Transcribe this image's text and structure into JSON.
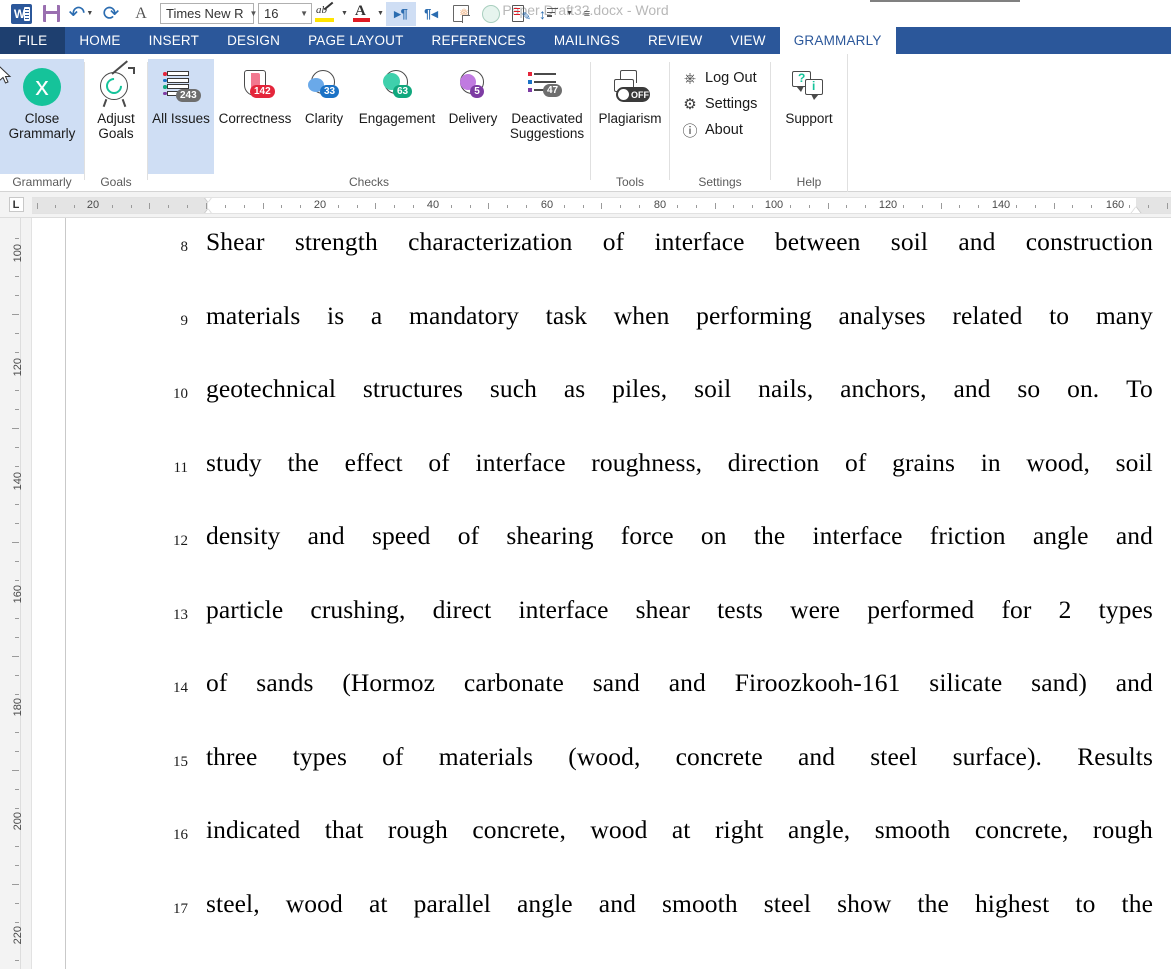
{
  "window": {
    "document_title": "Paper Draft32.docx - Word"
  },
  "quick_access": {
    "items": [
      {
        "name": "word-logo-icon",
        "label": "W"
      },
      {
        "name": "save-icon",
        "label": "Save"
      },
      {
        "name": "undo-icon",
        "label": "Undo"
      },
      {
        "name": "redo-icon",
        "label": "Redo"
      },
      {
        "name": "font-style-icon",
        "label": "A"
      },
      {
        "name": "highlight-icon",
        "label": "Text Highlight Color"
      },
      {
        "name": "font-color-icon",
        "label": "Font Color"
      },
      {
        "name": "ltr-text-direction-icon",
        "label": "Left-to-Right Text Direction"
      },
      {
        "name": "rtl-text-direction-icon",
        "label": "Right-to-Left Text Direction"
      },
      {
        "name": "new-document-icon",
        "label": "New"
      },
      {
        "name": "circle-icon",
        "label": "Circle"
      },
      {
        "name": "track-changes-icon",
        "label": "Track Changes"
      },
      {
        "name": "sort-icon",
        "label": "Sort"
      },
      {
        "name": "customize-toolbar-icon",
        "label": "Customize Quick Access Toolbar"
      }
    ],
    "font_name": "Times New R",
    "font_size": "16"
  },
  "ribbon_tabs": [
    {
      "label": "FILE",
      "active": false,
      "file": true
    },
    {
      "label": "HOME",
      "active": false
    },
    {
      "label": "INSERT",
      "active": false
    },
    {
      "label": "DESIGN",
      "active": false
    },
    {
      "label": "PAGE LAYOUT",
      "active": false
    },
    {
      "label": "REFERENCES",
      "active": false
    },
    {
      "label": "MAILINGS",
      "active": false
    },
    {
      "label": "REVIEW",
      "active": false
    },
    {
      "label": "VIEW",
      "active": false
    },
    {
      "label": "GRAMMARLY",
      "active": true
    }
  ],
  "ribbon": {
    "groups": {
      "grammarly": {
        "label": "Grammarly",
        "close_button": {
          "line1": "Close",
          "line2": "Grammarly",
          "selected": true
        }
      },
      "goals": {
        "label": "Goals",
        "adjust_button": {
          "line1": "Adjust",
          "line2": "Goals"
        }
      },
      "checks": {
        "label": "Checks",
        "buttons": [
          {
            "label": "All Issues",
            "badge": "243",
            "badge_color": "gray",
            "selected": true
          },
          {
            "label": "Correctness",
            "badge": "142",
            "badge_color": "red",
            "selected": false
          },
          {
            "label": "Clarity",
            "badge": "33",
            "badge_color": "blue",
            "selected": false
          },
          {
            "label": "Engagement",
            "badge": "63",
            "badge_color": "green",
            "selected": false
          },
          {
            "label": "Delivery",
            "badge": "5",
            "badge_color": "purple",
            "selected": false
          },
          {
            "label": "Deactivated Suggestions",
            "label_line1": "Deactivated",
            "label_line2": "Suggestions",
            "badge": "47",
            "badge_color": "gray",
            "selected": false
          }
        ]
      },
      "tools": {
        "label": "Tools",
        "plagiarism": {
          "label": "Plagiarism",
          "toggle": "OFF"
        }
      },
      "settings": {
        "label": "Settings",
        "items": [
          {
            "label": "Log Out",
            "icon": "power-icon"
          },
          {
            "label": "Settings",
            "icon": "gear-icon"
          },
          {
            "label": "About",
            "icon": "info-icon"
          }
        ]
      },
      "help": {
        "label": "Help",
        "support": {
          "label": "Support"
        }
      }
    }
  },
  "ruler": {
    "tab_stop_marker": "L",
    "horizontal_numbers": [
      "20",
      "20",
      "40",
      "60",
      "80",
      "100",
      "120",
      "140",
      "160"
    ],
    "vertical_numbers": [
      "100",
      "120",
      "140",
      "160",
      "180",
      "200",
      "220"
    ]
  },
  "document": {
    "lines": [
      {
        "number": "8",
        "text": "Shear strength characterization of interface between soil and construction",
        "words": [
          "Shear",
          "strength",
          "characterization",
          "of",
          "interface",
          "between",
          "soil",
          "and",
          "construction"
        ]
      },
      {
        "number": "9",
        "text": "materials is a mandatory task when performing analyses related to many",
        "words": [
          "materials",
          "is",
          "a",
          "mandatory",
          "task",
          "when",
          "performing",
          "analyses",
          "related",
          "to",
          "many"
        ]
      },
      {
        "number": "10",
        "text": "geotechnical structures such as piles, soil nails, anchors, and so on. To",
        "words": [
          "geotechnical",
          "structures",
          "such",
          "as",
          "piles,",
          "soil",
          "nails,",
          "anchors,",
          "and",
          "so",
          "on.",
          "To"
        ]
      },
      {
        "number": "11",
        "text": "study the effect of interface roughness, direction of grains in wood, soil",
        "words": [
          "study",
          "the",
          "effect",
          "of",
          "interface",
          "roughness,",
          "direction",
          "of",
          "grains",
          "in",
          "wood,",
          "soil"
        ]
      },
      {
        "number": "12",
        "text": "density and speed of shearing force on the interface friction angle and",
        "words": [
          "density",
          "and",
          "speed",
          "of",
          "shearing",
          "force",
          "on",
          "the",
          "interface",
          "friction",
          "angle",
          "and"
        ]
      },
      {
        "number": "13",
        "text": "particle crushing, direct interface shear tests were performed for 2 types",
        "words": [
          "particle",
          "crushing,",
          "direct",
          "interface",
          "shear",
          "tests",
          "were",
          "performed",
          "for",
          "2",
          "types"
        ]
      },
      {
        "number": "14",
        "text": "of sands (Hormoz carbonate sand and Firoozkooh-161 silicate sand) and",
        "words": [
          "of",
          "sands",
          "(Hormoz",
          "carbonate",
          "sand",
          "and",
          "Firoozkooh-161",
          "silicate",
          "sand)",
          "and"
        ]
      },
      {
        "number": "15",
        "text": "three types of materials (wood, concrete and steel surface). Results",
        "words": [
          "three",
          "types",
          "of",
          "materials",
          "(wood,",
          "concrete",
          "and",
          "steel",
          "surface).",
          "Results"
        ]
      },
      {
        "number": "16",
        "text": "indicated that rough concrete, wood at right angle, smooth concrete, rough",
        "words": [
          "indicated",
          "that",
          "rough",
          "concrete,",
          "wood",
          "at",
          "right",
          "angle,",
          "smooth",
          "concrete,",
          "rough"
        ]
      },
      {
        "number": "17",
        "text": "steel, wood at parallel angle and smooth steel show the highest to the",
        "words": [
          "steel,",
          "wood",
          "at",
          "parallel",
          "angle",
          "and",
          "smooth",
          "steel",
          "show",
          "the",
          "highest",
          "to",
          "the"
        ]
      }
    ]
  },
  "colors": {
    "word_blue": "#2b579a",
    "grammarly_green": "#15c39a",
    "selected_blue": "#cfdef4",
    "badge_red": "#e4263b",
    "badge_gray": "#6e6e6e",
    "badge_blue": "#1b72c6",
    "badge_green": "#11a87e",
    "badge_purple": "#7d3ca3"
  }
}
